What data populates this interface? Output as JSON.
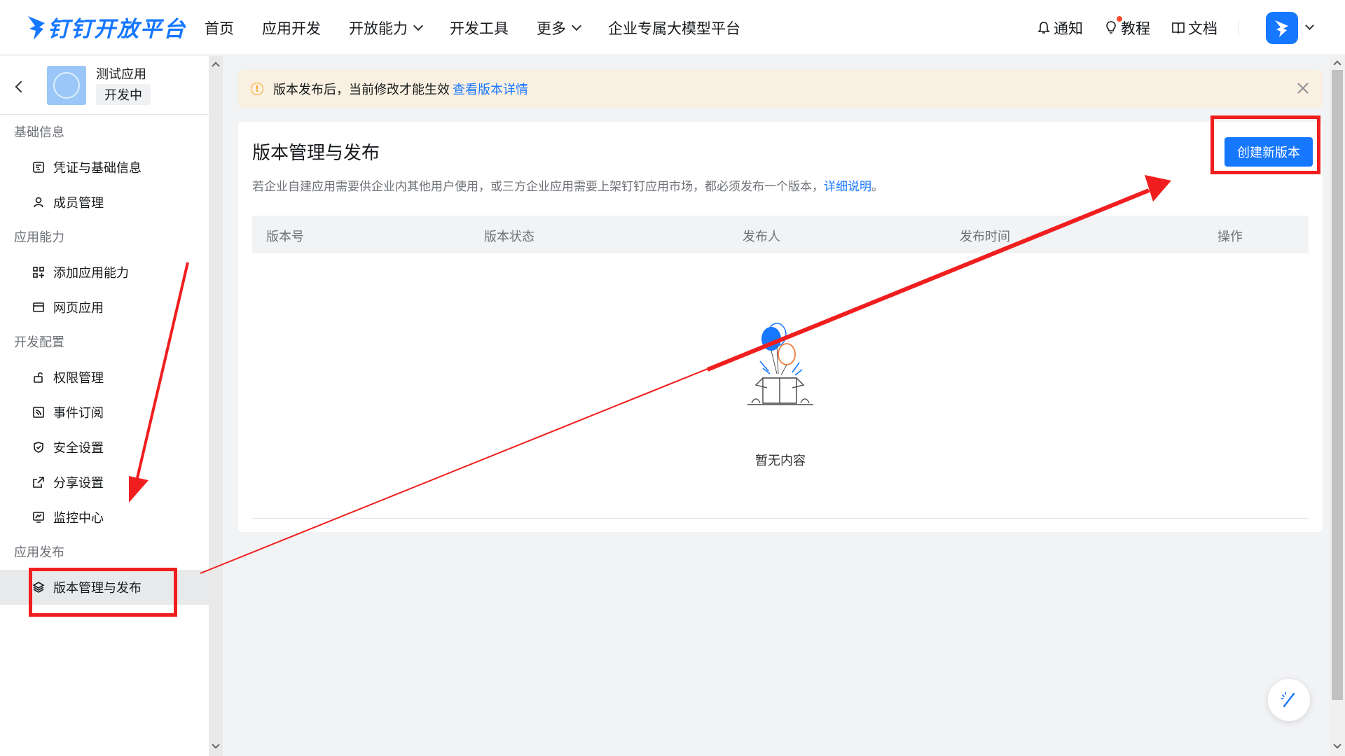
{
  "header": {
    "logo_text": "钉钉开放平台",
    "nav": [
      {
        "label": "首页"
      },
      {
        "label": "应用开发"
      },
      {
        "label": "开放能力",
        "has_dropdown": true
      },
      {
        "label": "开发工具"
      },
      {
        "label": "更多",
        "has_dropdown": true
      },
      {
        "label": "企业专属大模型平台"
      }
    ],
    "right": {
      "notify": "通知",
      "tutorial": "教程",
      "docs": "文档"
    }
  },
  "sidebar": {
    "app_name": "测试应用",
    "app_status": "开发中",
    "sections": [
      {
        "title": "基础信息",
        "items": [
          {
            "label": "凭证与基础信息",
            "icon": "credential-icon"
          },
          {
            "label": "成员管理",
            "icon": "user-icon"
          }
        ]
      },
      {
        "title": "应用能力",
        "items": [
          {
            "label": "添加应用能力",
            "icon": "apps-add-icon"
          },
          {
            "label": "网页应用",
            "icon": "browser-icon"
          }
        ]
      },
      {
        "title": "开发配置",
        "items": [
          {
            "label": "权限管理",
            "icon": "lock-icon"
          },
          {
            "label": "事件订阅",
            "icon": "rss-icon"
          },
          {
            "label": "安全设置",
            "icon": "shield-icon"
          },
          {
            "label": "分享设置",
            "icon": "share-icon"
          },
          {
            "label": "监控中心",
            "icon": "monitor-icon"
          }
        ]
      },
      {
        "title": "应用发布",
        "items": [
          {
            "label": "版本管理与发布",
            "icon": "layers-icon",
            "active": true
          }
        ]
      }
    ]
  },
  "alert": {
    "text": "版本发布后，当前修改才能生效",
    "link": "查看版本详情"
  },
  "main": {
    "title": "版本管理与发布",
    "description": "若企业自建应用需要供企业内其他用户使用，或三方企业应用需要上架钉钉应用市场，都必须发布一个版本，",
    "description_link": "详细说明",
    "description_end": "。",
    "create_button": "创建新版本",
    "columns": [
      "版本号",
      "版本状态",
      "发布人",
      "发布时间",
      "操作"
    ],
    "empty_text": "暂无内容"
  },
  "colors": {
    "brand": "#1677ff",
    "annotation": "#f01e1e",
    "alert_bg": "#faf0e1"
  }
}
